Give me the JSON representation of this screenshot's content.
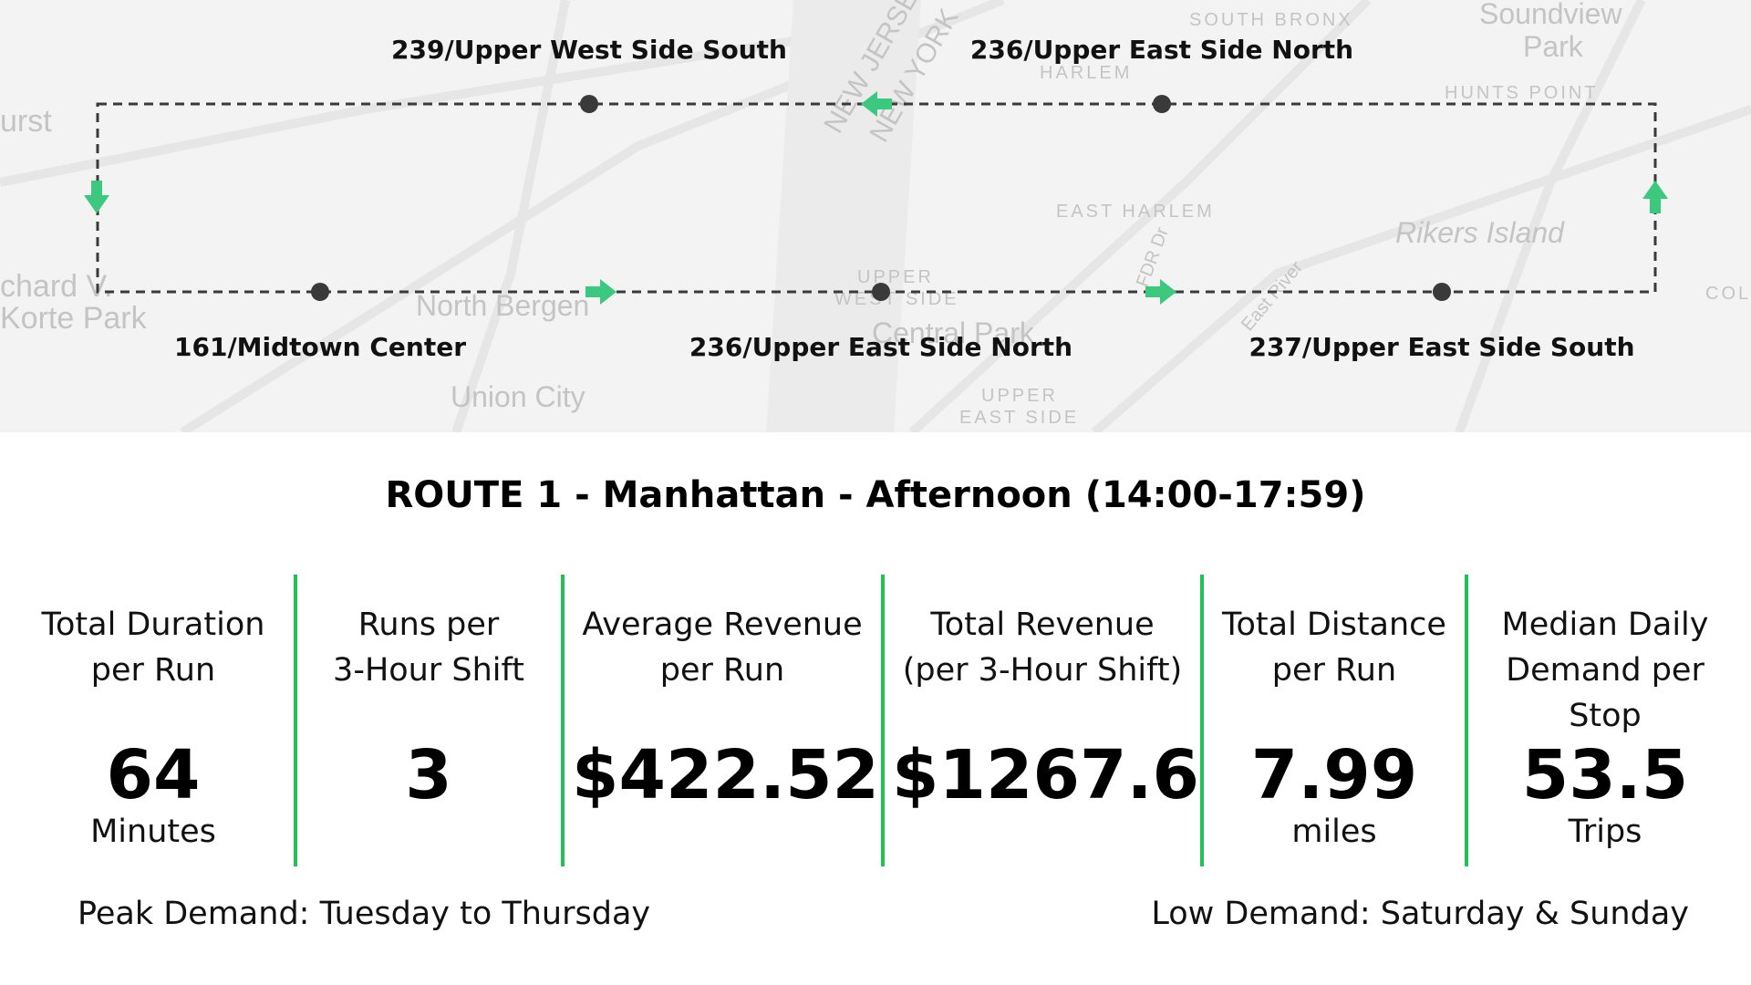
{
  "map": {
    "background_labels": [
      "urst",
      "chard V.",
      "Korte Park",
      "North Bergen",
      "Union City",
      "NEW JERSEY",
      "NEW YORK",
      "HARLEM",
      "SOUTH BRONX",
      "Soundview",
      "Park",
      "HUNTS POINT",
      "EAST HARLEM",
      "Rikers Island",
      "UPPER",
      "WEST SIDE",
      "Central Park",
      "UPPER",
      "EAST SIDE",
      "FDR Dr",
      "East River",
      "COL"
    ],
    "route_color": "#3a3a3a",
    "arrow_color": "#3cc97f",
    "stops": {
      "top_left": "239/Upper West Side South",
      "top_right": "236/Upper East Side North",
      "bottom_left": "161/Midtown Center",
      "bottom_mid": "236/Upper East Side North",
      "bottom_right": "237/Upper East Side South"
    }
  },
  "route_title": "ROUTE 1 - Manhattan - Afternoon (14:00-17:59)",
  "stats": [
    {
      "label": "Total Duration\nper Run",
      "value": "64",
      "unit": "Minutes"
    },
    {
      "label": "Runs per\n3-Hour Shift",
      "value": "3",
      "unit": ""
    },
    {
      "label": "Average Revenue\nper Run",
      "value": "$422.52",
      "unit": ""
    },
    {
      "label": "Total Revenue\n(per 3-Hour Shift)",
      "value": "$1267.6",
      "unit": ""
    },
    {
      "label": "Total Distance\nper Run",
      "value": "7.99",
      "unit": "miles"
    },
    {
      "label": "Median Daily\nDemand per\nStop",
      "value": "53.5",
      "unit": "Trips"
    }
  ],
  "footer": {
    "peak": "Peak Demand: Tuesday to Thursday",
    "low": "Low Demand: Saturday & Sunday"
  },
  "colors": {
    "divider": "#21c157",
    "map_bg": "#f3f3f3"
  }
}
